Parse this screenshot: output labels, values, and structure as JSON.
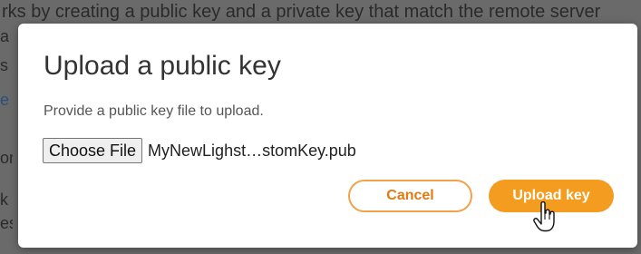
{
  "background": {
    "top_line": "rks by creating a public key and a private key that match the remote server",
    "fragments": [
      "a",
      "s",
      "e",
      "or",
      "k",
      "es"
    ]
  },
  "dialog": {
    "title": "Upload a public key",
    "description": "Provide a public key file to upload.",
    "file_input": {
      "button_label": "Choose File",
      "file_name": "MyNewLighst…stomKey.pub"
    },
    "cancel_label": "Cancel",
    "upload_label": "Upload key"
  },
  "colors": {
    "accent": "#f39c1f",
    "accent_text": "#e07b12",
    "overlay": "#6a6a6a"
  },
  "icons": {
    "pointer": "hand-pointer-icon"
  }
}
